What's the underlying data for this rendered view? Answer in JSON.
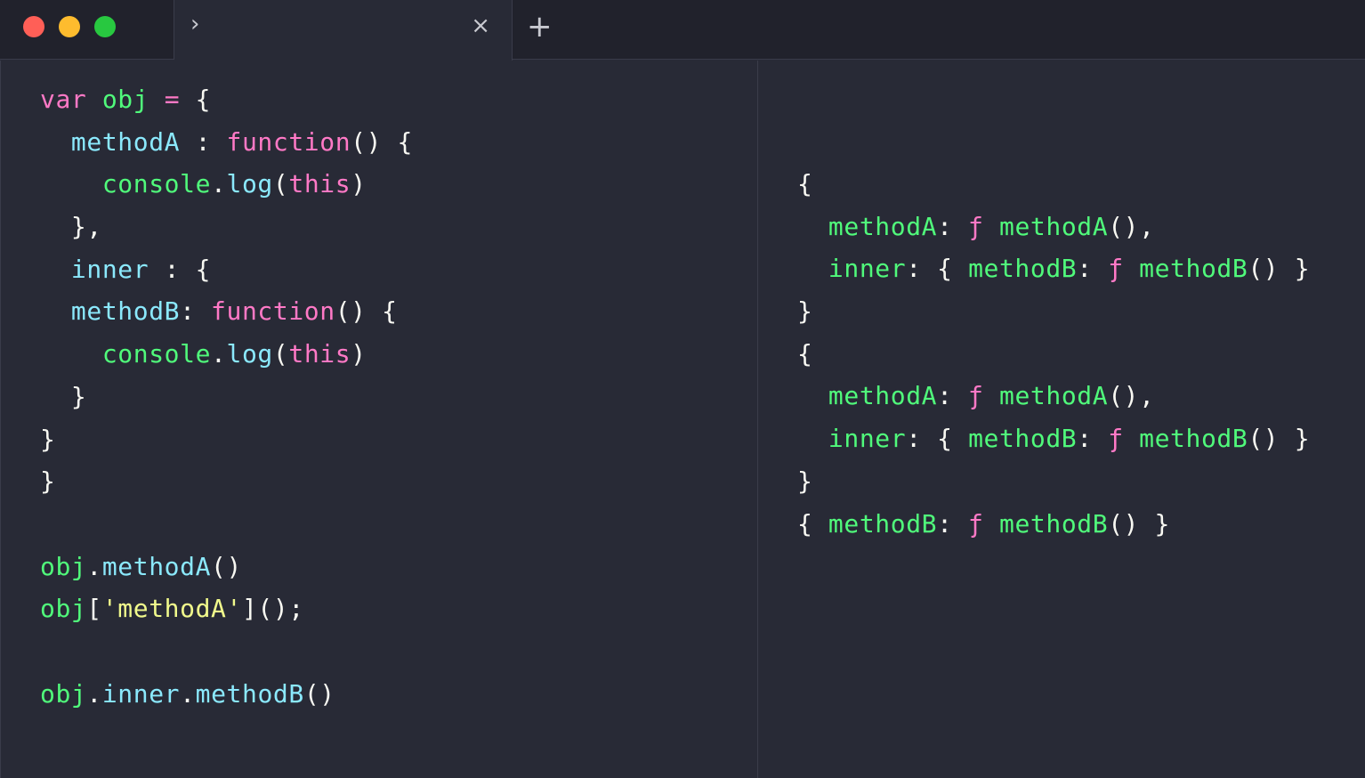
{
  "window": {
    "traffic_colors": {
      "close": "#ff5f57",
      "minimize": "#febc2e",
      "zoom": "#28c840"
    },
    "tab": {
      "prompt_glyph": "›",
      "close_glyph": "×"
    },
    "new_tab_glyph": "+"
  },
  "editor": {
    "lines": [
      [
        {
          "t": "var",
          "c": "kw"
        },
        {
          "t": " ",
          "c": "pl"
        },
        {
          "t": "obj",
          "c": "var"
        },
        {
          "t": " ",
          "c": "pl"
        },
        {
          "t": "=",
          "c": "kw"
        },
        {
          "t": " {",
          "c": "pl"
        }
      ],
      [
        {
          "t": "  ",
          "c": "pl"
        },
        {
          "t": "methodA",
          "c": "prop"
        },
        {
          "t": " : ",
          "c": "pl"
        },
        {
          "t": "function",
          "c": "fn"
        },
        {
          "t": "() {",
          "c": "pl"
        }
      ],
      [
        {
          "t": "    ",
          "c": "pl"
        },
        {
          "t": "console",
          "c": "var"
        },
        {
          "t": ".",
          "c": "pl"
        },
        {
          "t": "log",
          "c": "prop"
        },
        {
          "t": "(",
          "c": "pl"
        },
        {
          "t": "this",
          "c": "kw"
        },
        {
          "t": ")",
          "c": "pl"
        }
      ],
      [
        {
          "t": "  },",
          "c": "pl"
        }
      ],
      [
        {
          "t": "  ",
          "c": "pl"
        },
        {
          "t": "inner",
          "c": "prop"
        },
        {
          "t": " : {",
          "c": "pl"
        }
      ],
      [
        {
          "t": "  ",
          "c": "pl"
        },
        {
          "t": "methodB",
          "c": "prop"
        },
        {
          "t": ": ",
          "c": "pl"
        },
        {
          "t": "function",
          "c": "fn"
        },
        {
          "t": "() {",
          "c": "pl"
        }
      ],
      [
        {
          "t": "    ",
          "c": "pl"
        },
        {
          "t": "console",
          "c": "var"
        },
        {
          "t": ".",
          "c": "pl"
        },
        {
          "t": "log",
          "c": "prop"
        },
        {
          "t": "(",
          "c": "pl"
        },
        {
          "t": "this",
          "c": "kw"
        },
        {
          "t": ")",
          "c": "pl"
        }
      ],
      [
        {
          "t": "  }",
          "c": "pl"
        }
      ],
      [
        {
          "t": "}",
          "c": "pl"
        }
      ],
      [
        {
          "t": "}",
          "c": "pl"
        }
      ],
      [
        {
          "t": "",
          "c": "pl"
        }
      ],
      [
        {
          "t": "obj",
          "c": "var"
        },
        {
          "t": ".",
          "c": "pl"
        },
        {
          "t": "methodA",
          "c": "prop"
        },
        {
          "t": "()",
          "c": "pl"
        }
      ],
      [
        {
          "t": "obj",
          "c": "var"
        },
        {
          "t": "[",
          "c": "pl"
        },
        {
          "t": "'methodA'",
          "c": "str"
        },
        {
          "t": "]();",
          "c": "pl"
        }
      ],
      [
        {
          "t": "",
          "c": "pl"
        }
      ],
      [
        {
          "t": "obj",
          "c": "var"
        },
        {
          "t": ".",
          "c": "pl"
        },
        {
          "t": "inner",
          "c": "prop"
        },
        {
          "t": ".",
          "c": "pl"
        },
        {
          "t": "methodB",
          "c": "prop"
        },
        {
          "t": "()",
          "c": "pl"
        }
      ]
    ]
  },
  "console": {
    "lines": [
      [
        {
          "t": "{",
          "c": "pl"
        }
      ],
      [
        {
          "t": "  ",
          "c": "pl"
        },
        {
          "t": "methodA",
          "c": "green"
        },
        {
          "t": ": ",
          "c": "pl"
        },
        {
          "t": "ƒ",
          "c": "fn"
        },
        {
          "t": " ",
          "c": "pl"
        },
        {
          "t": "methodA",
          "c": "green"
        },
        {
          "t": "(),",
          "c": "pl"
        }
      ],
      [
        {
          "t": "  ",
          "c": "pl"
        },
        {
          "t": "inner",
          "c": "green"
        },
        {
          "t": ": { ",
          "c": "pl"
        },
        {
          "t": "methodB",
          "c": "green"
        },
        {
          "t": ": ",
          "c": "pl"
        },
        {
          "t": "ƒ",
          "c": "fn"
        },
        {
          "t": " ",
          "c": "pl"
        },
        {
          "t": "methodB",
          "c": "green"
        },
        {
          "t": "() }",
          "c": "pl"
        }
      ],
      [
        {
          "t": "}",
          "c": "pl"
        }
      ],
      [
        {
          "t": "{",
          "c": "pl"
        }
      ],
      [
        {
          "t": "  ",
          "c": "pl"
        },
        {
          "t": "methodA",
          "c": "green"
        },
        {
          "t": ": ",
          "c": "pl"
        },
        {
          "t": "ƒ",
          "c": "fn"
        },
        {
          "t": " ",
          "c": "pl"
        },
        {
          "t": "methodA",
          "c": "green"
        },
        {
          "t": "(),",
          "c": "pl"
        }
      ],
      [
        {
          "t": "  ",
          "c": "pl"
        },
        {
          "t": "inner",
          "c": "green"
        },
        {
          "t": ": { ",
          "c": "pl"
        },
        {
          "t": "methodB",
          "c": "green"
        },
        {
          "t": ": ",
          "c": "pl"
        },
        {
          "t": "ƒ",
          "c": "fn"
        },
        {
          "t": " ",
          "c": "pl"
        },
        {
          "t": "methodB",
          "c": "green"
        },
        {
          "t": "() }",
          "c": "pl"
        }
      ],
      [
        {
          "t": "}",
          "c": "pl"
        }
      ],
      [
        {
          "t": "{ ",
          "c": "pl"
        },
        {
          "t": "methodB",
          "c": "green"
        },
        {
          "t": ": ",
          "c": "pl"
        },
        {
          "t": "ƒ",
          "c": "fn"
        },
        {
          "t": " ",
          "c": "pl"
        },
        {
          "t": "methodB",
          "c": "green"
        },
        {
          "t": "() }",
          "c": "pl"
        }
      ]
    ]
  }
}
